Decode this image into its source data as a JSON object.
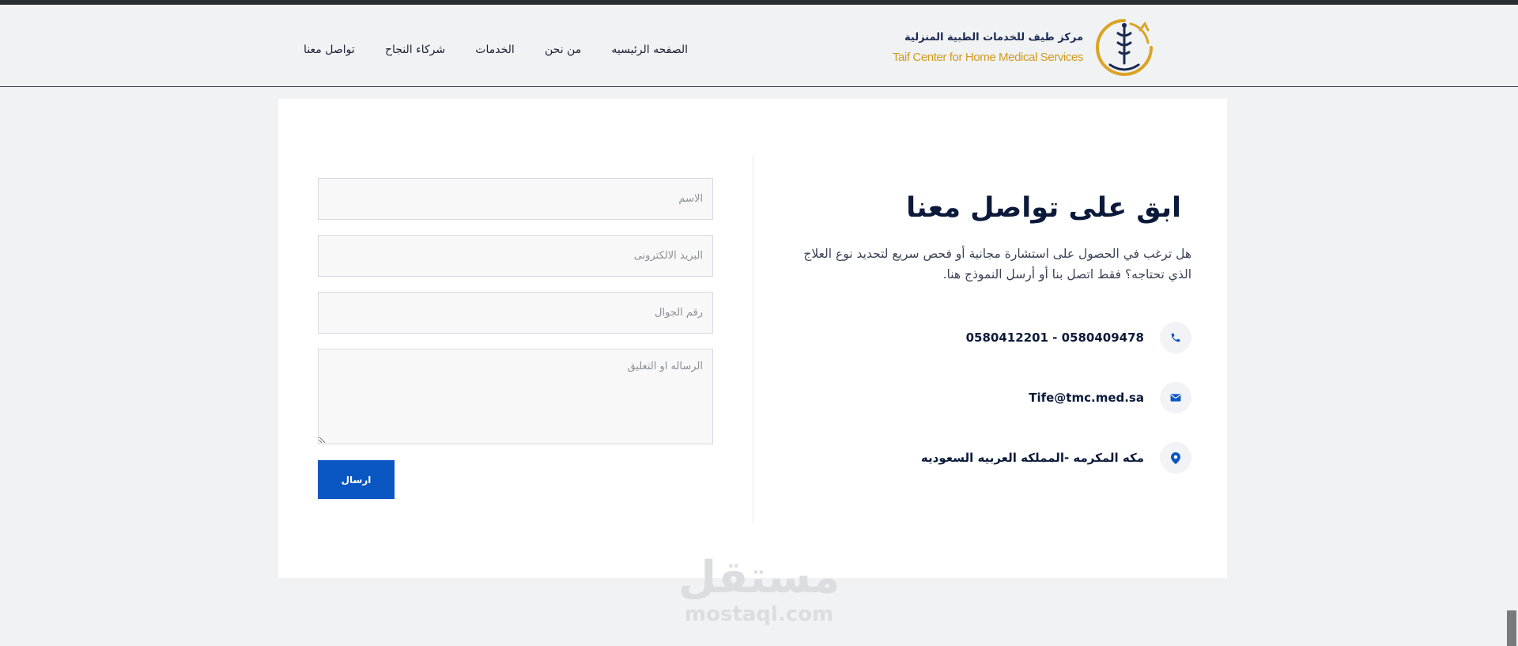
{
  "header": {
    "logo": {
      "name_ar": "مركز طيف للخدمات الطبية المنزلية",
      "name_en": "Taif Center for Home Medical Services"
    },
    "nav": [
      {
        "label": "الصفحه الرئيسيه"
      },
      {
        "label": "من نحن"
      },
      {
        "label": "الخدمات"
      },
      {
        "label": "شركاء النجاح"
      },
      {
        "label": "تواصل معنا"
      }
    ]
  },
  "contact": {
    "title": "ابق على تواصل معنا",
    "description": "هل ترغب في الحصول على استشارة مجانية أو فحص سريع لتحديد نوع العلاج الذي تحتاجه؟ فقط اتصل بنا أو أرسل النموذج هنا.",
    "phone": "0580409478 - 0580412201",
    "email": "Tife@tmc.med.sa",
    "address": "مكه المكرمه -المملكه العربيه السعوديه"
  },
  "form": {
    "name_placeholder": "الاسم",
    "email_placeholder": "البريد الالكترونى",
    "mobile_placeholder": "رقم الجوال",
    "message_placeholder": "الرساله او التعليق",
    "submit_label": "ارسال"
  },
  "watermark": {
    "text_ar": "مستقل",
    "text_en": "mostaql.com"
  },
  "colors": {
    "accent": "#0a56c3",
    "heading": "#0b1a3a",
    "logo_gold": "#d19a1f",
    "page_bg": "#f1f2f4"
  },
  "icons": {
    "phone": "phone-icon",
    "email": "envelope-icon",
    "address": "map-pin-icon"
  }
}
